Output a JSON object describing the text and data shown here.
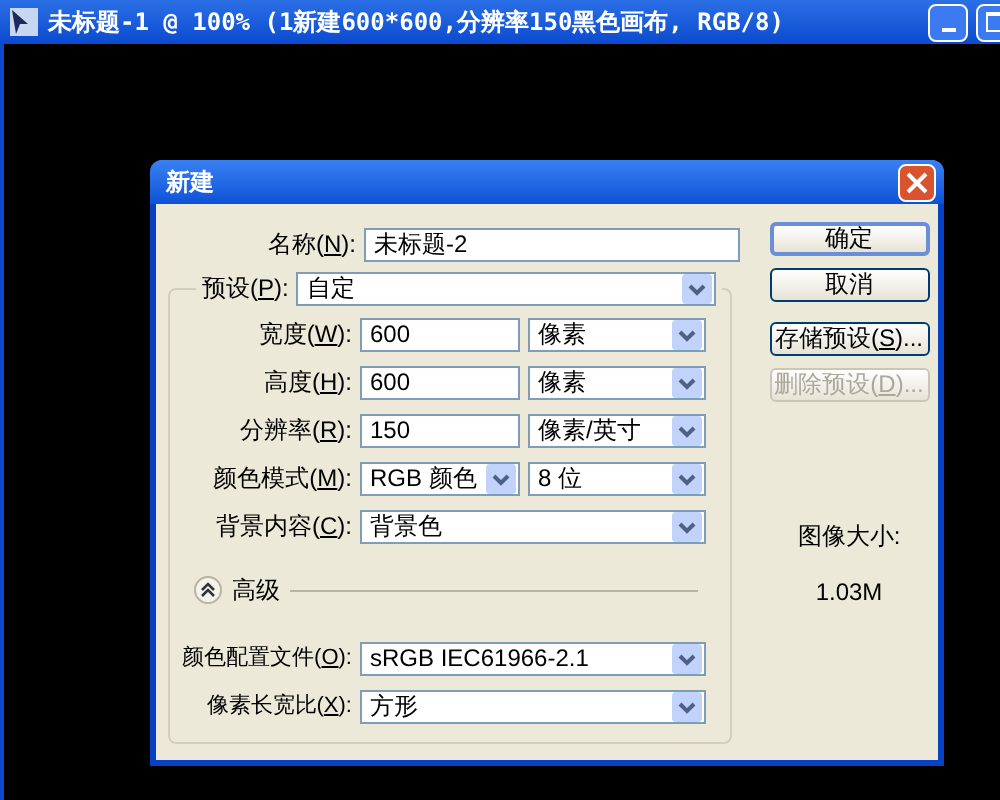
{
  "window": {
    "title": "未标题-1 @ 100% (1新建600*600,分辨率150黑色画布, RGB/8)"
  },
  "dialog": {
    "title": "新建",
    "name_field": {
      "label": {
        "before": "名称(",
        "key": "N",
        "after": "):"
      },
      "value": "未标题-2"
    },
    "preset": {
      "label": {
        "before": "预设(",
        "key": "P",
        "after": "):"
      },
      "value": "自定"
    },
    "fields": [
      {
        "kind": "number",
        "label": {
          "before": "宽度(",
          "key": "W",
          "after": "):"
        },
        "value": "600",
        "unit": "像素"
      },
      {
        "kind": "number",
        "label": {
          "before": "高度(",
          "key": "H",
          "after": "):"
        },
        "value": "600",
        "unit": "像素"
      },
      {
        "kind": "number",
        "label": {
          "before": "分辨率(",
          "key": "R",
          "after": "):"
        },
        "value": "150",
        "unit": "像素/英寸"
      },
      {
        "kind": "select_pair",
        "label": {
          "before": "颜色模式(",
          "key": "M",
          "after": "):"
        },
        "value": "RGB 颜色",
        "unit": "8 位"
      },
      {
        "kind": "select",
        "label": {
          "before": "背景内容(",
          "key": "C",
          "after": "):"
        },
        "value": "背景色"
      }
    ],
    "advanced": {
      "label": "高级",
      "expanded": true
    },
    "advanced_fields": [
      {
        "kind": "select",
        "label": {
          "before": "颜色配置文件(",
          "key": "O",
          "after": "):"
        },
        "value": "sRGB IEC61966-2.1"
      },
      {
        "kind": "select",
        "label": {
          "before": "像素长宽比(",
          "key": "X",
          "after": "):"
        },
        "value": "方形"
      }
    ],
    "buttons": [
      {
        "label": {
          "before": "确定"
        },
        "default": true,
        "disabled": false
      },
      {
        "label": {
          "before": "取消"
        },
        "default": false,
        "disabled": false
      },
      {
        "label": {
          "before": "存储预设(",
          "key": "S",
          "after": ")..."
        },
        "default": false,
        "disabled": false
      },
      {
        "label": {
          "before": "删除预设(",
          "key": "D",
          "after": ")..."
        },
        "default": false,
        "disabled": true
      }
    ],
    "image_size": {
      "label": "图像大小:",
      "value": "1.03M"
    }
  }
}
